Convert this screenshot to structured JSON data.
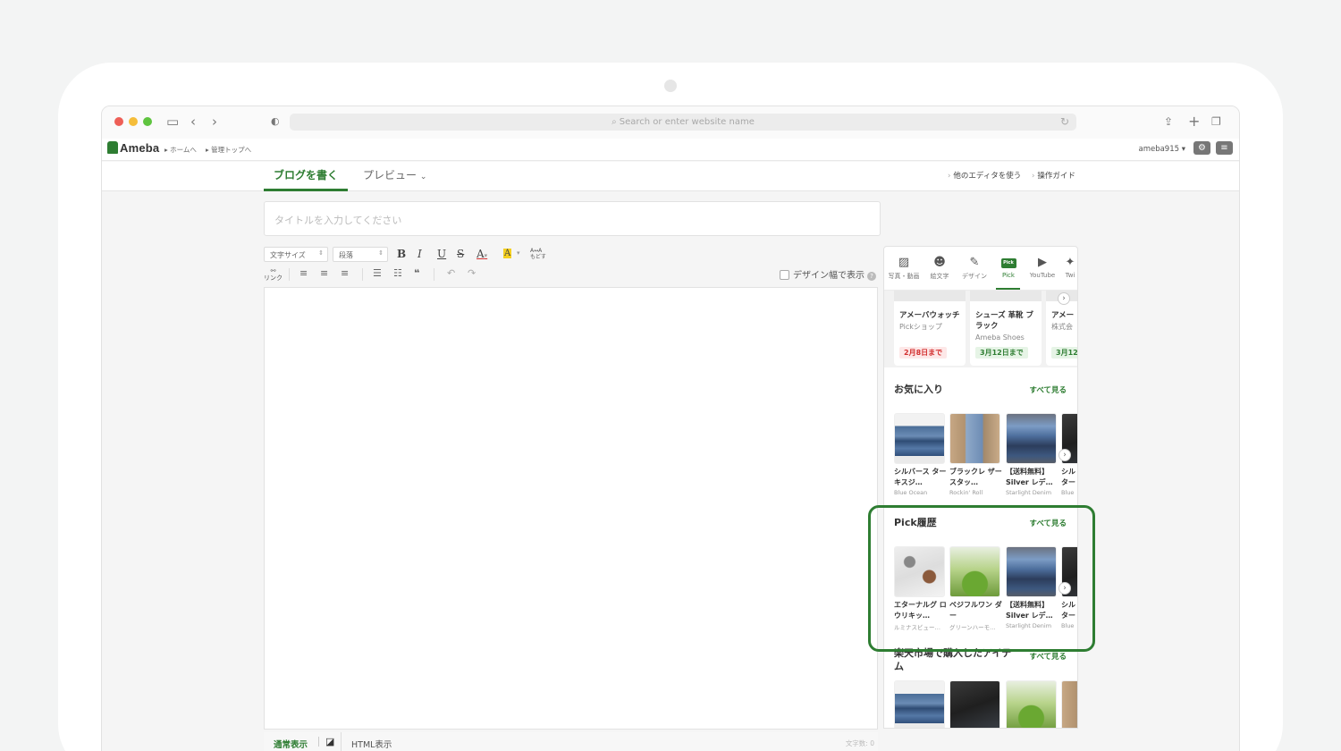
{
  "browser": {
    "url_placeholder": "Search or enter website name"
  },
  "ameba": {
    "logo": "Ameba",
    "crumbs": [
      "ホームへ",
      "管理トップへ"
    ],
    "user": "ameba915"
  },
  "editor_tabs": {
    "write": "ブログを書く",
    "preview": "プレビュー",
    "other_editor": "他のエディタを使う",
    "guide": "操作ガイド"
  },
  "title_placeholder": "タイトルを入力してください",
  "toolbar": {
    "font_size": "文字サイズ",
    "paragraph": "段落",
    "bold": "B",
    "italic": "I",
    "underline": "U",
    "strike": "S",
    "text_color": "A",
    "bg_color": "A",
    "moji": "もどす",
    "link": "リンク",
    "design_width": "デザイン幅で表示"
  },
  "bottom": {
    "normal": "通常表示",
    "html": "HTML表示",
    "count": "文字数: 0"
  },
  "panel": {
    "tabs": [
      {
        "label": "写真・動画",
        "icon": "photo-icon"
      },
      {
        "label": "絵文字",
        "icon": "emoji-icon"
      },
      {
        "label": "デザイン",
        "icon": "design-icon"
      },
      {
        "label": "Pick",
        "icon": "pick-icon",
        "badge": "Pick"
      },
      {
        "label": "YouTube",
        "icon": "youtube-icon"
      },
      {
        "label": "Twi",
        "icon": "twitter-icon"
      }
    ],
    "cards": [
      {
        "name": "アメーバウォッチ",
        "shop": "Pickショップ",
        "deadline": "2月8日まで",
        "color": "#d32f2f"
      },
      {
        "name": "シューズ 革靴 ブラック",
        "shop": "Ameba Shoes",
        "deadline": "3月12日まで",
        "color": "#2e7d32"
      },
      {
        "name": "アメー",
        "shop": "株式会",
        "deadline": "3月12",
        "color": "#2e7d32"
      }
    ],
    "favorites": {
      "title": "お気に入り",
      "all": "すべて見る",
      "items": [
        {
          "name": "シルバース ターキスジ…",
          "shop": "Blue Ocean"
        },
        {
          "name": "ブラックレ ザースタッ…",
          "shop": "Rockin' Roll"
        },
        {
          "name": "【送料無料】 Silver レデ…",
          "shop": "Starlight Denim"
        },
        {
          "name": "シル ター",
          "shop": "Blue"
        }
      ]
    },
    "history": {
      "title": "Pick履歴",
      "all": "すべて見る",
      "items": [
        {
          "name": "エターナルグ ロウリキッ…",
          "shop": "ルミナスビュー…"
        },
        {
          "name": "ベジフルワン ダー",
          "shop": "グリーンハーモ…"
        },
        {
          "name": "【送料無料】 Silver レデ…",
          "shop": "Starlight Denim"
        },
        {
          "name": "シル ター",
          "shop": "Blue"
        }
      ]
    },
    "rakuten": {
      "title": "楽天市場で購入したアイテム",
      "all": "すべて見る"
    }
  }
}
